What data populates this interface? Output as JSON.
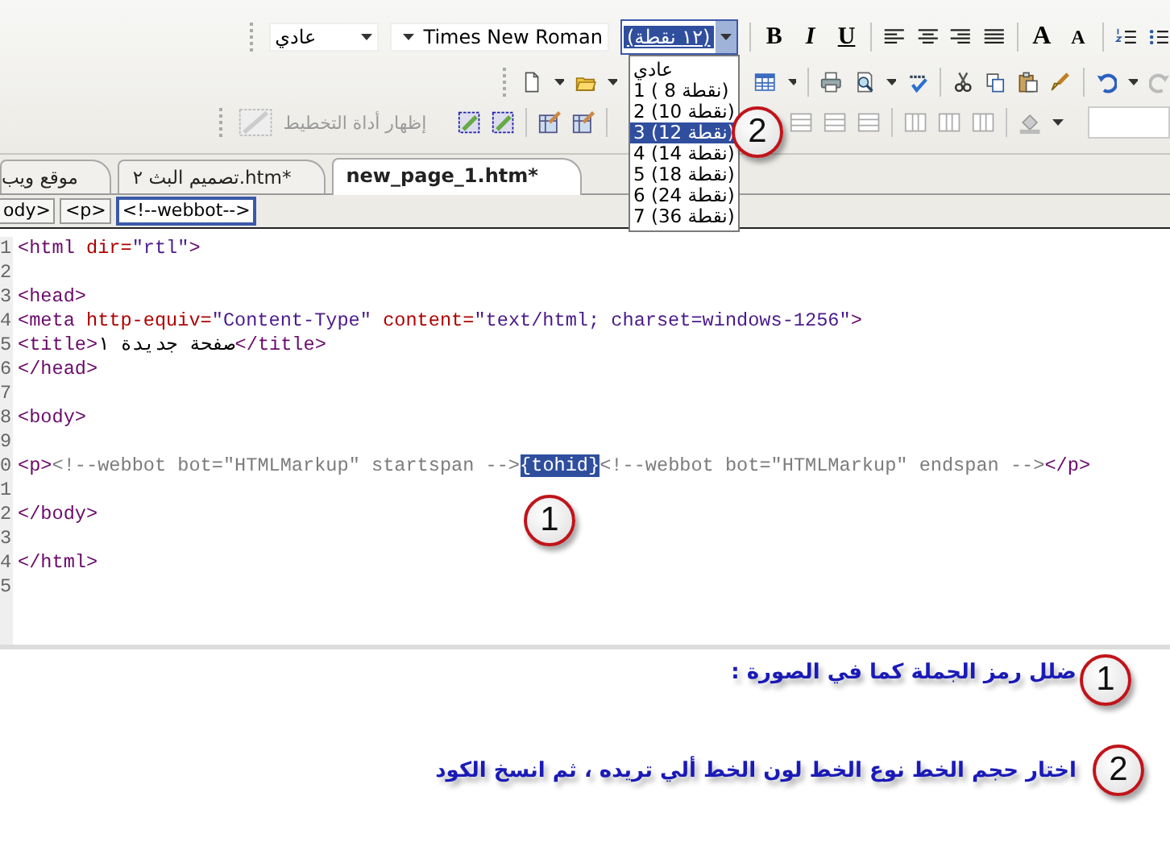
{
  "toolbar": {
    "style": "عادي",
    "font": "Times New Roman",
    "size": "(١٢ نقطة)",
    "bold": "B",
    "italic": "I",
    "underline": "U",
    "grow_font": "A",
    "shrink_font": "A",
    "layout_tool": "إظهار أداة التخطيط",
    "callout": "2"
  },
  "size_dropdown": {
    "items": [
      {
        "label": "عادي",
        "selected": false
      },
      {
        "label": "1 ( 8 نقطة)",
        "selected": false
      },
      {
        "label": "2 (10 نقطة)",
        "selected": false
      },
      {
        "label": "3 (12 نقطة)",
        "selected": true
      },
      {
        "label": "4 (14 نقطة)",
        "selected": false
      },
      {
        "label": "5 (18 نقطة)",
        "selected": false
      },
      {
        "label": "6 (24 نقطة)",
        "selected": false
      },
      {
        "label": "7 (36 نقطة)",
        "selected": false
      }
    ]
  },
  "tabs": [
    {
      "label": "new_page_1.htm*",
      "selected": true
    },
    {
      "label": "تصميم البث ٢.htm*",
      "selected": false
    },
    {
      "label": "موقع ويب",
      "selected": false
    }
  ],
  "tag_path": [
    {
      "label": "<!--webbot-->",
      "selected": true
    },
    {
      "label": "<p>",
      "selected": false
    },
    {
      "label": "ody>",
      "selected": false
    }
  ],
  "code": {
    "callout": "1",
    "lines": [
      {
        "number": "1",
        "text": "<html dir=\"rtl\">"
      },
      {
        "number": "2"
      },
      {
        "number": "3",
        "text": "<head>"
      },
      {
        "number": "4",
        "text": "<meta http-equiv=\"Content-Type\" content=\"text/html; charset=windows-1256\">"
      },
      {
        "number": "5",
        "text": "<title>صفحة جديدة ١</title>"
      },
      {
        "number": "6",
        "text": "</head>"
      },
      {
        "number": "7"
      },
      {
        "number": "8",
        "text": "<body>"
      },
      {
        "number": "9"
      },
      {
        "number": "0",
        "text": "<p><!--webbot bot=\"HTMLMarkup\" startspan -->",
        "selected_text": "{tohid}",
        "text_after": "<!--webbot bot=\"HTMLMarkup\" endspan --></p>"
      },
      {
        "number": "1"
      },
      {
        "number": "2",
        "text": "</body>"
      },
      {
        "number": "3"
      },
      {
        "number": "4",
        "text": "</html>"
      },
      {
        "number": "5"
      }
    ]
  },
  "instructions": [
    {
      "number": "1",
      "text": "ضلل رمز الجملة كما في الصورة :"
    },
    {
      "number": "2",
      "text": "اختار حجم الخط نوع الخط لون الخط ألي تريده ، ثم انسخ الكود"
    }
  ]
}
